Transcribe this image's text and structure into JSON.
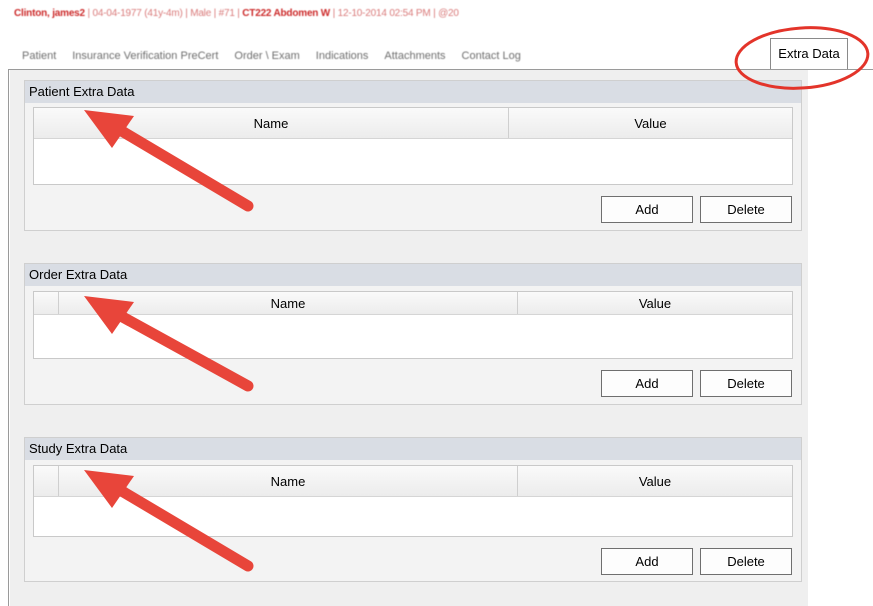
{
  "header": {
    "patient_name": "Clinton, james2",
    "dob": "04-04-1977 (41y-4m)",
    "gender": "Male",
    "number": "#71",
    "exam": "CT222 Abdomen W",
    "datetime": "12-10-2014 02:54 PM",
    "extra": "@20",
    "separator": " | "
  },
  "tabs": [
    {
      "label": "Patient"
    },
    {
      "label": "Insurance Verification PreCert"
    },
    {
      "label": "Order \\ Exam"
    },
    {
      "label": "Indications"
    },
    {
      "label": "Attachments"
    },
    {
      "label": "Contact Log"
    },
    {
      "label": "Extra Data"
    }
  ],
  "sections": [
    {
      "title": "Patient Extra Data",
      "col_name": "Name",
      "col_value": "Value",
      "add_label": "Add",
      "delete_label": "Delete"
    },
    {
      "title": "Order Extra Data",
      "col_name": "Name",
      "col_value": "Value",
      "add_label": "Add",
      "delete_label": "Delete"
    },
    {
      "title": "Study Extra Data",
      "col_name": "Name",
      "col_value": "Value",
      "add_label": "Add",
      "delete_label": "Delete"
    }
  ],
  "annotations": {
    "arrow_color": "#e8453a",
    "circle_color": "#e3342a"
  }
}
